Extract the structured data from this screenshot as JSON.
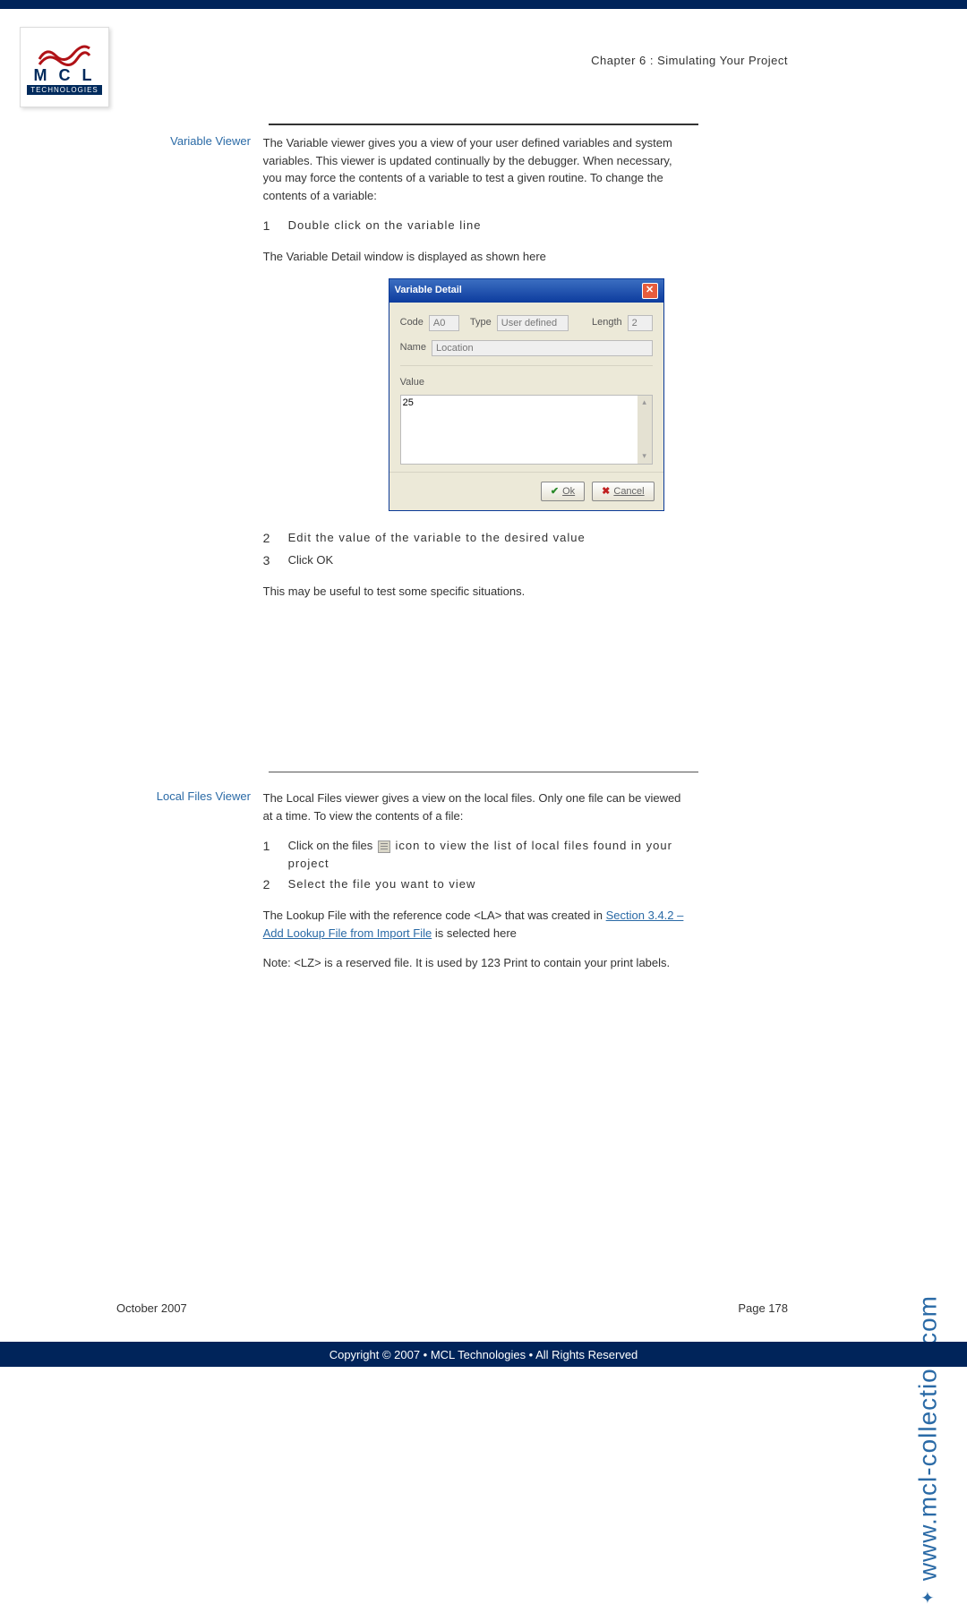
{
  "header": {
    "chapter": "Chapter 6 : Simulating Your Project"
  },
  "logo": {
    "line1": "M C L",
    "line2": "TECHNOLOGIES"
  },
  "variable_viewer": {
    "label": "Variable Viewer",
    "intro": "The Variable viewer gives you a view of your user defined variables and system variables. This viewer is updated continually by the debugger. When necessary, you may force the contents of a variable to test a given routine. To change the contents of a variable:",
    "step1_num": "1",
    "step1": "Double click on the variable line",
    "displayed_text": "The Variable Detail window is displayed as shown here",
    "step2_num": "2",
    "step2": "Edit the value of the variable to the desired value",
    "step3_num": "3",
    "step3": "Click OK",
    "closing": "This may be useful to test some specific situations."
  },
  "dialog": {
    "title": "Variable Detail",
    "code_label": "Code",
    "code_value": "A0",
    "type_label": "Type",
    "type_value": "User defined",
    "length_label": "Length",
    "length_value": "2",
    "name_label": "Name",
    "name_value": "Location",
    "value_label": "Value",
    "value_value": "25",
    "ok_label": "Ok",
    "cancel_label": "Cancel"
  },
  "local_files_viewer": {
    "label": "Local Files Viewer",
    "intro": "The Local Files viewer gives a view on the local files. Only one file can be viewed at a time. To view the contents of a file:",
    "step1_num": "1",
    "step1_pre": "Click on the files ",
    "step1_post": " icon to view the list of local files found in your project",
    "step2_num": "2",
    "step2": "Select the file you want to view",
    "lookup_pre": "The Lookup File with the reference code <LA> that was created in ",
    "lookup_link": "Section 3.4.2 – Add Lookup File from Import File",
    "lookup_post": " is selected here",
    "note": "Note: <LZ> is a reserved file. It is used by 123 Print to contain your print labels."
  },
  "footer": {
    "date": "October 2007",
    "page": "Page 178"
  },
  "bottom_bar": "Copyright © 2007 • MCL Technologies • All Rights Reserved",
  "side_url": "www.mcl-collection.com"
}
